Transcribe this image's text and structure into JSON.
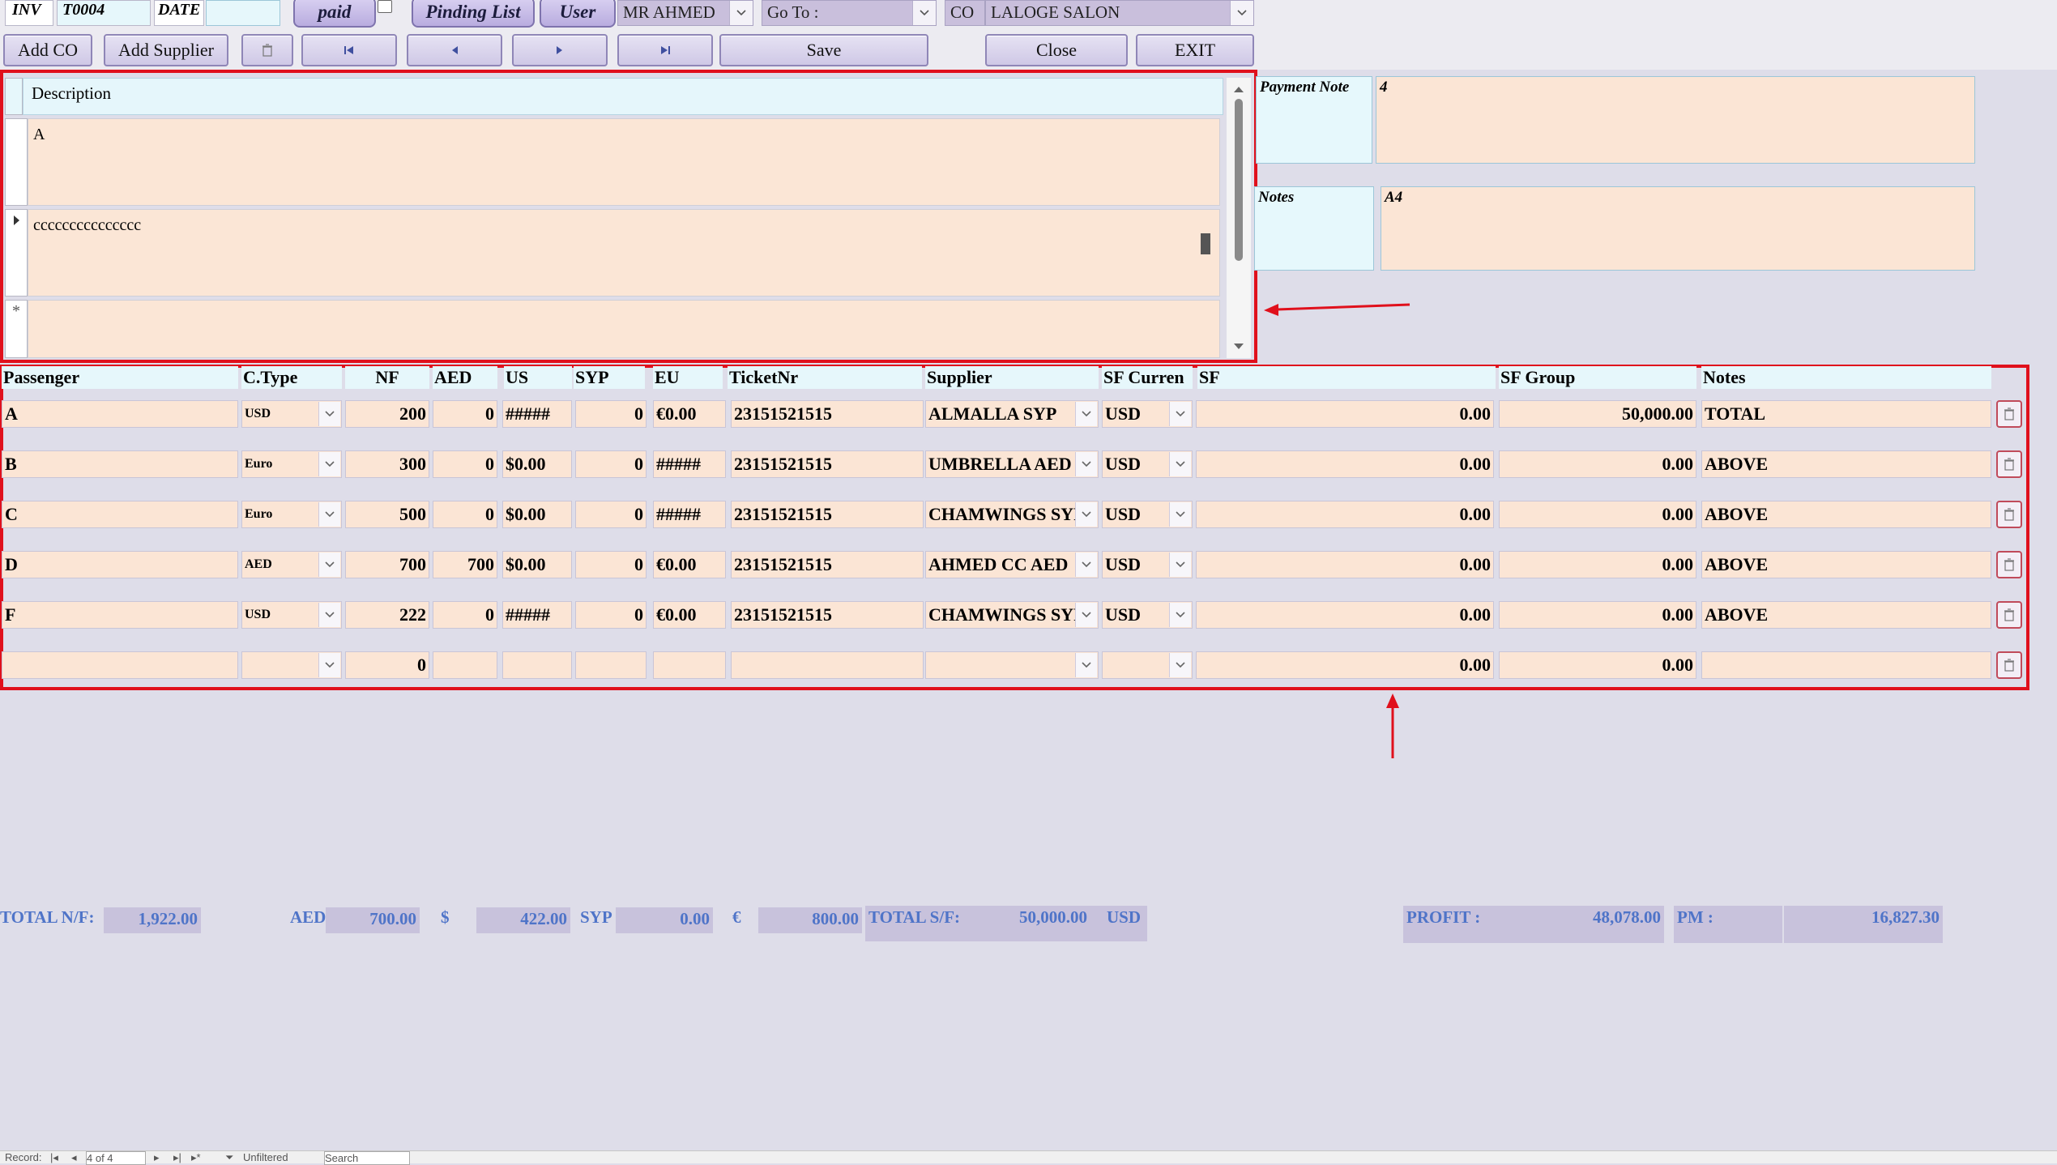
{
  "header": {
    "inv_label": "INV",
    "inv_value": "T0004",
    "date_label": "DATE",
    "date_value": "",
    "paid_label": "paid",
    "pinding_label": "Pinding List",
    "user_label": "User",
    "user_value": "MR AHMED",
    "goto_label": "Go To :",
    "goto_value": "",
    "co_label": "CO",
    "co_value": "LALOGE SALON"
  },
  "toolbar": {
    "add_co": "Add CO",
    "add_supplier": "Add Supplier",
    "save": "Save",
    "close": "Close",
    "exit": "EXIT"
  },
  "description": {
    "header": "Description",
    "rows": [
      "A",
      "ccccccccccccccc",
      ""
    ]
  },
  "notes": {
    "payment_note_label": "Payment Note",
    "payment_note_value": "4",
    "notes_label": "Notes",
    "notes_value": "A4"
  },
  "grid": {
    "columns": [
      "Passenger",
      "C.Type",
      "NF",
      "AED",
      "US",
      "SYP",
      "EU",
      "TicketNr",
      "Supplier",
      "SF Curren",
      "SF",
      "SF Group",
      "Notes"
    ],
    "rows": [
      {
        "passenger": "A",
        "ctype": "USD",
        "nf": "200",
        "aed": "0",
        "us": "#####",
        "syp": "0",
        "eu": "€0.00",
        "ticket": "23151521515",
        "supplier": "ALMALLA SYP",
        "sfcur": "USD",
        "sf": "0.00",
        "sfgroup": "50,000.00",
        "notes": "TOTAL"
      },
      {
        "passenger": "B",
        "ctype": "Euro",
        "nf": "300",
        "aed": "0",
        "us": "$0.00",
        "syp": "0",
        "eu": "#####",
        "ticket": "23151521515",
        "supplier": "UMBRELLA AED",
        "sfcur": "USD",
        "sf": "0.00",
        "sfgroup": "0.00",
        "notes": "ABOVE"
      },
      {
        "passenger": "C",
        "ctype": "Euro",
        "nf": "500",
        "aed": "0",
        "us": "$0.00",
        "syp": "0",
        "eu": "#####",
        "ticket": "23151521515",
        "supplier": "CHAMWINGS SYP",
        "sfcur": "USD",
        "sf": "0.00",
        "sfgroup": "0.00",
        "notes": "ABOVE"
      },
      {
        "passenger": "D",
        "ctype": "AED",
        "nf": "700",
        "aed": "700",
        "us": "$0.00",
        "syp": "0",
        "eu": "€0.00",
        "ticket": "23151521515",
        "supplier": "AHMED CC AED",
        "sfcur": "USD",
        "sf": "0.00",
        "sfgroup": "0.00",
        "notes": "ABOVE"
      },
      {
        "passenger": "F",
        "ctype": "USD",
        "nf": "222",
        "aed": "0",
        "us": "#####",
        "syp": "0",
        "eu": "€0.00",
        "ticket": "23151521515",
        "supplier": "CHAMWINGS SYP",
        "sfcur": "USD",
        "sf": "0.00",
        "sfgroup": "0.00",
        "notes": "ABOVE"
      },
      {
        "passenger": "",
        "ctype": "",
        "nf": "0",
        "aed": "",
        "us": "",
        "syp": "",
        "eu": "",
        "ticket": "",
        "supplier": "",
        "sfcur": "",
        "sf": "0.00",
        "sfgroup": "0.00",
        "notes": ""
      }
    ]
  },
  "totals": {
    "total_nf_label": "TOTAL N/F:",
    "total_nf": "1,922.00",
    "aed_label": "AED",
    "aed": "700.00",
    "usd_label": "$",
    "usd": "422.00",
    "syp_label": "SYP",
    "syp": "0.00",
    "eur_label": "€",
    "eur": "800.00",
    "total_sf_label": "TOTAL S/F:",
    "total_sf": "50,000.00",
    "sf_currency": "USD",
    "profit_label": "PROFIT :",
    "profit": "48,078.00",
    "pm_label": "PM :",
    "pm": "16,827.30"
  },
  "status": {
    "record_label": "Record:",
    "record_pos": "4 of 4",
    "filter": "Unfiltered",
    "search": "Search"
  },
  "colors": {
    "accent_red": "#e0101c",
    "field_bg": "#fbe5d5",
    "total_text": "#4f74c8"
  }
}
